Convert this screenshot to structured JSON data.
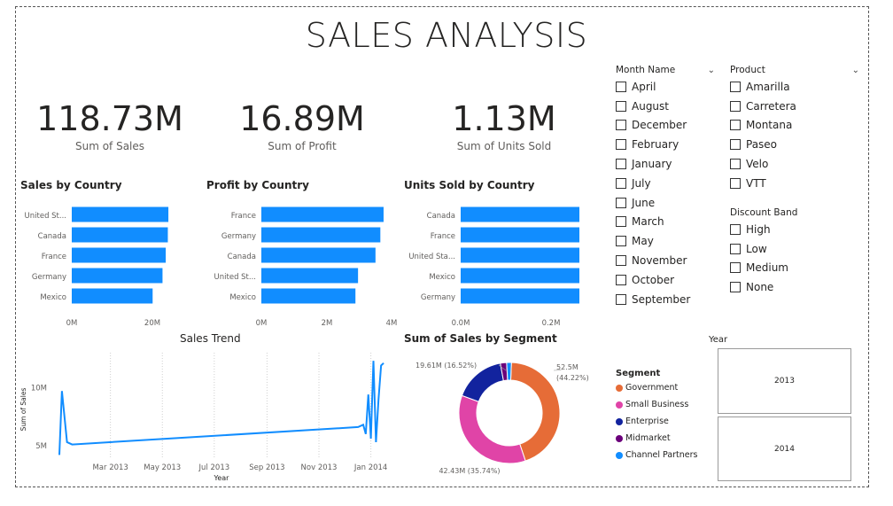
{
  "title": "SALES ANALYSIS",
  "kpis": [
    {
      "value": "118.73M",
      "label": "Sum of Sales"
    },
    {
      "value": "16.89M",
      "label": "Sum of Profit"
    },
    {
      "value": "1.13M",
      "label": "Sum of Units Sold"
    }
  ],
  "colors": {
    "bar": "#118dff",
    "government": "#e66c37",
    "small_business": "#e044a7",
    "enterprise": "#12239e",
    "midmarket": "#6b007b",
    "channel_partners": "#118dff"
  },
  "chart_data": [
    {
      "type": "bar",
      "title": "Sales by Country",
      "categories": [
        "United St...",
        "Canada",
        "France",
        "Germany",
        "Mexico"
      ],
      "values": [
        25.03,
        24.89,
        24.35,
        23.51,
        20.95
      ],
      "xticks": [
        "0M",
        "20M"
      ],
      "xlim": [
        0,
        28
      ]
    },
    {
      "type": "bar",
      "title": "Profit by Country",
      "categories": [
        "France",
        "Germany",
        "Canada",
        "United St...",
        "Mexico"
      ],
      "values": [
        3.78,
        3.68,
        3.53,
        2.99,
        2.91
      ],
      "xticks": [
        "0M",
        "2M",
        "4M"
      ],
      "xlim": [
        0,
        4
      ]
    },
    {
      "type": "bar",
      "title": "Units Sold by Country",
      "categories": [
        "Canada",
        "France",
        "United Sta...",
        "Mexico",
        "Germany"
      ],
      "values": [
        0.247,
        0.241,
        0.233,
        0.203,
        0.201
      ],
      "xticks": [
        "0.0M",
        "0.2M"
      ],
      "xlim": [
        0,
        0.265
      ]
    },
    {
      "type": "line",
      "title": "Sales Trend",
      "xlabel": "Year",
      "ylabel": "Sum of Sales",
      "xticks": [
        "Mar 2013",
        "May 2013",
        "Jul 2013",
        "Sep 2013",
        "Nov 2013",
        "Jan 2014"
      ],
      "yticks": [
        "5M",
        "10M"
      ],
      "x": [
        "2012-12-31",
        "2013-01-03",
        "2013-01-09",
        "2013-01-15",
        "2013-12-17",
        "2013-12-23",
        "2013-12-26",
        "2013-12-29",
        "2014-01-01",
        "2014-01-04",
        "2014-01-07",
        "2014-01-10",
        "2014-01-13",
        "2014-01-16"
      ],
      "y": [
        4.2,
        9.7,
        5.3,
        5.1,
        6.6,
        6.8,
        6.0,
        9.4,
        5.6,
        12.3,
        5.3,
        9.0,
        11.9,
        12.1
      ],
      "ylim": [
        4,
        13
      ]
    },
    {
      "type": "pie",
      "title": "Sum of Sales by Segment",
      "labels": [
        "Government",
        "Small Business",
        "Enterprise",
        "Midmarket",
        "Channel Partners"
      ],
      "values": [
        52.5,
        42.43,
        19.61,
        2.38,
        1.8
      ],
      "data_labels": [
        {
          "value": "52.5M",
          "pct": "(44.22%)"
        },
        {
          "value": "42.43M (35.74%)"
        },
        {
          "value": "19.61M (16.52%)"
        }
      ]
    }
  ],
  "legend": {
    "title": "Segment",
    "items": [
      "Government",
      "Small Business",
      "Enterprise",
      "Midmarket",
      "Channel Partners"
    ]
  },
  "slicers": {
    "month": {
      "title": "Month Name",
      "items": [
        "April",
        "August",
        "December",
        "February",
        "January",
        "July",
        "June",
        "March",
        "May",
        "November",
        "October",
        "September"
      ]
    },
    "product": {
      "title": "Product",
      "items": [
        "Amarilla",
        "Carretera",
        "Montana",
        "Paseo",
        "Velo",
        "VTT"
      ]
    },
    "discount": {
      "title": "Discount Band",
      "items": [
        "High",
        "Low",
        "Medium",
        "None"
      ]
    },
    "year": {
      "title": "Year",
      "items": [
        "2013",
        "2014"
      ]
    }
  }
}
